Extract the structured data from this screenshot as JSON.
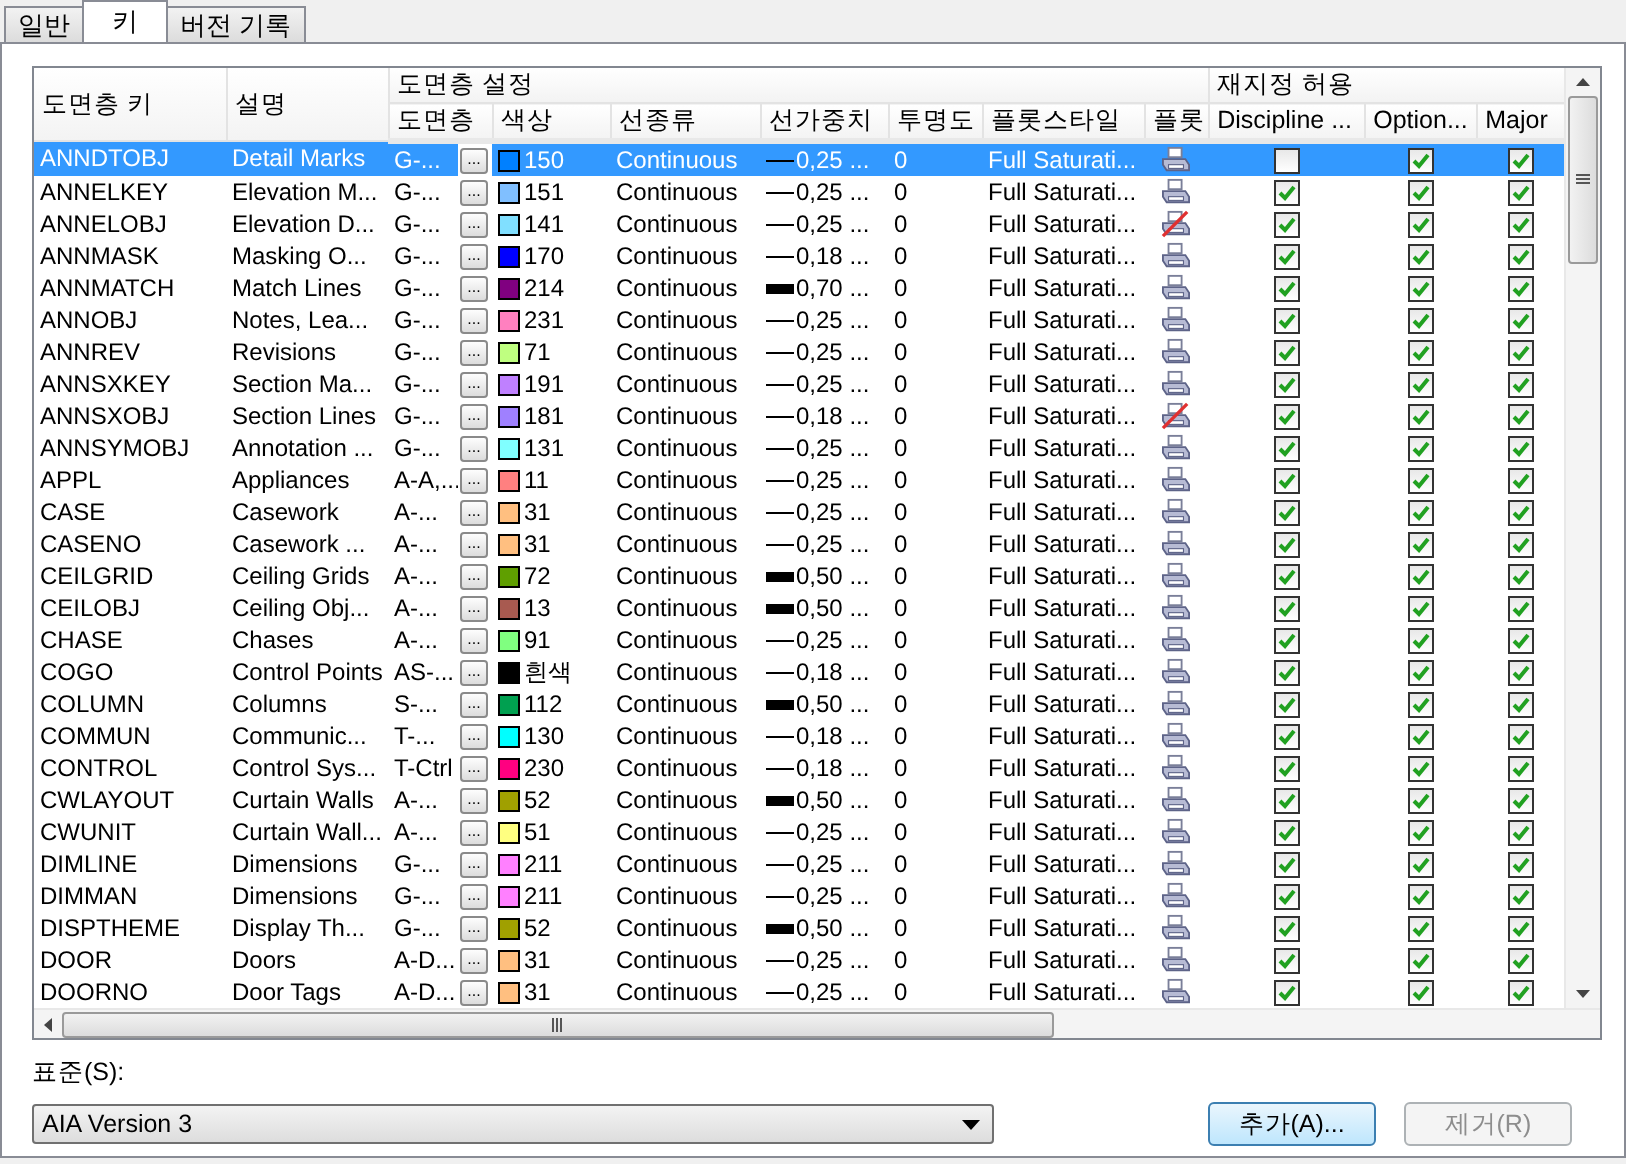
{
  "tabs": [
    {
      "label": "일반",
      "selected": false
    },
    {
      "label": "키",
      "selected": true
    },
    {
      "label": "버전 기록",
      "selected": false
    }
  ],
  "table": {
    "group_headers": [
      "도면층 설정",
      "재지정 허용"
    ],
    "columns": [
      "도면층 키",
      "설명",
      "도면층",
      "색상",
      "선종류",
      "선가중치",
      "투명도",
      "플롯스타일",
      "플롯",
      "Discipline ...",
      "Option...",
      "Major"
    ],
    "rows": [
      {
        "key": "ANNDTOBJ",
        "desc": "Detail Marks",
        "layer": "G-...",
        "btn": "...",
        "color_label": "150",
        "color": "#0080ff",
        "linetype": "Continuous",
        "heavy": false,
        "lw": "0,25 ...",
        "transparency": "0",
        "plotstyle": "Full Saturati...",
        "plot": true,
        "discipline": false,
        "option": true,
        "major": true,
        "selected": true
      },
      {
        "key": "ANNELKEY",
        "desc": "Elevation M...",
        "layer": "G-...",
        "btn": "...",
        "color_label": "151",
        "color": "#80bfff",
        "linetype": "Continuous",
        "heavy": false,
        "lw": "0,25 ...",
        "transparency": "0",
        "plotstyle": "Full Saturati...",
        "plot": true,
        "discipline": true,
        "option": true,
        "major": true,
        "selected": false
      },
      {
        "key": "ANNELOBJ",
        "desc": "Elevation D...",
        "layer": "G-...",
        "btn": "...",
        "color_label": "141",
        "color": "#80dfff",
        "linetype": "Continuous",
        "heavy": false,
        "lw": "0,25 ...",
        "transparency": "0",
        "plotstyle": "Full Saturati...",
        "plot": false,
        "discipline": true,
        "option": true,
        "major": true,
        "selected": false
      },
      {
        "key": "ANNMASK",
        "desc": "Masking O...",
        "layer": "G-...",
        "btn": "...",
        "color_label": "170",
        "color": "#0000ff",
        "linetype": "Continuous",
        "heavy": false,
        "lw": "0,18 ...",
        "transparency": "0",
        "plotstyle": "Full Saturati...",
        "plot": true,
        "discipline": true,
        "option": true,
        "major": true,
        "selected": false
      },
      {
        "key": "ANNMATCH",
        "desc": "Match Lines",
        "layer": "G-...",
        "btn": "...",
        "color_label": "214",
        "color": "#800080",
        "linetype": "Continuous",
        "heavy": true,
        "lw": "0,70 ...",
        "transparency": "0",
        "plotstyle": "Full Saturati...",
        "plot": true,
        "discipline": true,
        "option": true,
        "major": true,
        "selected": false
      },
      {
        "key": "ANNOBJ",
        "desc": "Notes, Lea...",
        "layer": "G-...",
        "btn": "...",
        "color_label": "231",
        "color": "#ff80bf",
        "linetype": "Continuous",
        "heavy": false,
        "lw": "0,25 ...",
        "transparency": "0",
        "plotstyle": "Full Saturati...",
        "plot": true,
        "discipline": true,
        "option": true,
        "major": true,
        "selected": false
      },
      {
        "key": "ANNREV",
        "desc": "Revisions",
        "layer": "G-...",
        "btn": "...",
        "color_label": "71",
        "color": "#bfff80",
        "linetype": "Continuous",
        "heavy": false,
        "lw": "0,25 ...",
        "transparency": "0",
        "plotstyle": "Full Saturati...",
        "plot": true,
        "discipline": true,
        "option": true,
        "major": true,
        "selected": false
      },
      {
        "key": "ANNSXKEY",
        "desc": "Section Ma...",
        "layer": "G-...",
        "btn": "...",
        "color_label": "191",
        "color": "#bf80ff",
        "linetype": "Continuous",
        "heavy": false,
        "lw": "0,25 ...",
        "transparency": "0",
        "plotstyle": "Full Saturati...",
        "plot": true,
        "discipline": true,
        "option": true,
        "major": true,
        "selected": false
      },
      {
        "key": "ANNSXOBJ",
        "desc": "Section Lines",
        "layer": "G-...",
        "btn": "...",
        "color_label": "181",
        "color": "#9f80ff",
        "linetype": "Continuous",
        "heavy": false,
        "lw": "0,18 ...",
        "transparency": "0",
        "plotstyle": "Full Saturati...",
        "plot": false,
        "discipline": true,
        "option": true,
        "major": true,
        "selected": false
      },
      {
        "key": "ANNSYMOBJ",
        "desc": "Annotation ...",
        "layer": "G-...",
        "btn": "...",
        "color_label": "131",
        "color": "#80ffff",
        "linetype": "Continuous",
        "heavy": false,
        "lw": "0,25 ...",
        "transparency": "0",
        "plotstyle": "Full Saturati...",
        "plot": true,
        "discipline": true,
        "option": true,
        "major": true,
        "selected": false
      },
      {
        "key": "APPL",
        "desc": "Appliances",
        "layer": "A-A,...",
        "btn": "...",
        "color_label": "11",
        "color": "#ff8080",
        "linetype": "Continuous",
        "heavy": false,
        "lw": "0,25 ...",
        "transparency": "0",
        "plotstyle": "Full Saturati...",
        "plot": true,
        "discipline": true,
        "option": true,
        "major": true,
        "selected": false
      },
      {
        "key": "CASE",
        "desc": "Casework",
        "layer": "A-...",
        "btn": "...",
        "color_label": "31",
        "color": "#ffbf80",
        "linetype": "Continuous",
        "heavy": false,
        "lw": "0,25 ...",
        "transparency": "0",
        "plotstyle": "Full Saturati...",
        "plot": true,
        "discipline": true,
        "option": true,
        "major": true,
        "selected": false
      },
      {
        "key": "CASENO",
        "desc": "Casework ...",
        "layer": "A-...",
        "btn": "...",
        "color_label": "31",
        "color": "#ffbf80",
        "linetype": "Continuous",
        "heavy": false,
        "lw": "0,25 ...",
        "transparency": "0",
        "plotstyle": "Full Saturati...",
        "plot": true,
        "discipline": true,
        "option": true,
        "major": true,
        "selected": false
      },
      {
        "key": "CEILGRID",
        "desc": "Ceiling Grids",
        "layer": "A-...",
        "btn": "...",
        "color_label": "72",
        "color": "#5f9f00",
        "linetype": "Continuous",
        "heavy": true,
        "lw": "0,50 ...",
        "transparency": "0",
        "plotstyle": "Full Saturati...",
        "plot": true,
        "discipline": true,
        "option": true,
        "major": true,
        "selected": false
      },
      {
        "key": "CEILOBJ",
        "desc": "Ceiling Obj...",
        "layer": "A-...",
        "btn": "...",
        "color_label": "13",
        "color": "#a85a50",
        "linetype": "Continuous",
        "heavy": true,
        "lw": "0,50 ...",
        "transparency": "0",
        "plotstyle": "Full Saturati...",
        "plot": true,
        "discipline": true,
        "option": true,
        "major": true,
        "selected": false
      },
      {
        "key": "CHASE",
        "desc": "Chases",
        "layer": "A-...",
        "btn": "...",
        "color_label": "91",
        "color": "#80ff80",
        "linetype": "Continuous",
        "heavy": false,
        "lw": "0,25 ...",
        "transparency": "0",
        "plotstyle": "Full Saturati...",
        "plot": true,
        "discipline": true,
        "option": true,
        "major": true,
        "selected": false
      },
      {
        "key": "COGO",
        "desc": "Control Points",
        "layer": "AS-...",
        "btn": "...",
        "color_label": "흰색",
        "color": "#000000",
        "linetype": "Continuous",
        "heavy": false,
        "lw": "0,18 ...",
        "transparency": "0",
        "plotstyle": "Full Saturati...",
        "plot": true,
        "discipline": true,
        "option": true,
        "major": true,
        "selected": false
      },
      {
        "key": "COLUMN",
        "desc": "Columns",
        "layer": "S-...",
        "btn": "...",
        "color_label": "112",
        "color": "#00a050",
        "linetype": "Continuous",
        "heavy": true,
        "lw": "0,50 ...",
        "transparency": "0",
        "plotstyle": "Full Saturati...",
        "plot": true,
        "discipline": true,
        "option": true,
        "major": true,
        "selected": false
      },
      {
        "key": "COMMUN",
        "desc": "Communic...",
        "layer": "T-...",
        "btn": "...",
        "color_label": "130",
        "color": "#00ffff",
        "linetype": "Continuous",
        "heavy": false,
        "lw": "0,18 ...",
        "transparency": "0",
        "plotstyle": "Full Saturati...",
        "plot": true,
        "discipline": true,
        "option": true,
        "major": true,
        "selected": false
      },
      {
        "key": "CONTROL",
        "desc": "Control Sys...",
        "layer": "T-Ctrl",
        "btn": "...",
        "color_label": "230",
        "color": "#ff0080",
        "linetype": "Continuous",
        "heavy": false,
        "lw": "0,18 ...",
        "transparency": "0",
        "plotstyle": "Full Saturati...",
        "plot": true,
        "discipline": true,
        "option": true,
        "major": true,
        "selected": false
      },
      {
        "key": "CWLAYOUT",
        "desc": "Curtain Walls",
        "layer": "A-...",
        "btn": "...",
        "color_label": "52",
        "color": "#a0a000",
        "linetype": "Continuous",
        "heavy": true,
        "lw": "0,50 ...",
        "transparency": "0",
        "plotstyle": "Full Saturati...",
        "plot": true,
        "discipline": true,
        "option": true,
        "major": true,
        "selected": false
      },
      {
        "key": "CWUNIT",
        "desc": "Curtain Wall...",
        "layer": "A-...",
        "btn": "...",
        "color_label": "51",
        "color": "#ffff80",
        "linetype": "Continuous",
        "heavy": false,
        "lw": "0,25 ...",
        "transparency": "0",
        "plotstyle": "Full Saturati...",
        "plot": true,
        "discipline": true,
        "option": true,
        "major": true,
        "selected": false
      },
      {
        "key": "DIMLINE",
        "desc": "Dimensions",
        "layer": "G-...",
        "btn": "...",
        "color_label": "211",
        "color": "#ff80ff",
        "linetype": "Continuous",
        "heavy": false,
        "lw": "0,25 ...",
        "transparency": "0",
        "plotstyle": "Full Saturati...",
        "plot": true,
        "discipline": true,
        "option": true,
        "major": true,
        "selected": false
      },
      {
        "key": "DIMMAN",
        "desc": "Dimensions",
        "layer": "G-...",
        "btn": "...",
        "color_label": "211",
        "color": "#ff80ff",
        "linetype": "Continuous",
        "heavy": false,
        "lw": "0,25 ...",
        "transparency": "0",
        "plotstyle": "Full Saturati...",
        "plot": true,
        "discipline": true,
        "option": true,
        "major": true,
        "selected": false
      },
      {
        "key": "DISPTHEME",
        "desc": "Display Th...",
        "layer": "G-...",
        "btn": "...",
        "color_label": "52",
        "color": "#a0a000",
        "linetype": "Continuous",
        "heavy": true,
        "lw": "0,50 ...",
        "transparency": "0",
        "plotstyle": "Full Saturati...",
        "plot": true,
        "discipline": true,
        "option": true,
        "major": true,
        "selected": false
      },
      {
        "key": "DOOR",
        "desc": "Doors",
        "layer": "A-D...",
        "btn": "...",
        "color_label": "31",
        "color": "#ffbf80",
        "linetype": "Continuous",
        "heavy": false,
        "lw": "0,25 ...",
        "transparency": "0",
        "plotstyle": "Full Saturati...",
        "plot": true,
        "discipline": true,
        "option": true,
        "major": true,
        "selected": false
      },
      {
        "key": "DOORNO",
        "desc": "Door Tags",
        "layer": "A-D...",
        "btn": "...",
        "color_label": "31",
        "color": "#ffbf80",
        "linetype": "Continuous",
        "heavy": false,
        "lw": "0,25 ...",
        "transparency": "0",
        "plotstyle": "Full Saturati...",
        "plot": true,
        "discipline": true,
        "option": true,
        "major": true,
        "selected": false
      }
    ]
  },
  "standard": {
    "label": "표준(S):",
    "value": "AIA Version 3"
  },
  "buttons": [
    {
      "label": "추가(A)...",
      "disabled": false
    },
    {
      "label": "제거(R)",
      "disabled": true
    }
  ]
}
